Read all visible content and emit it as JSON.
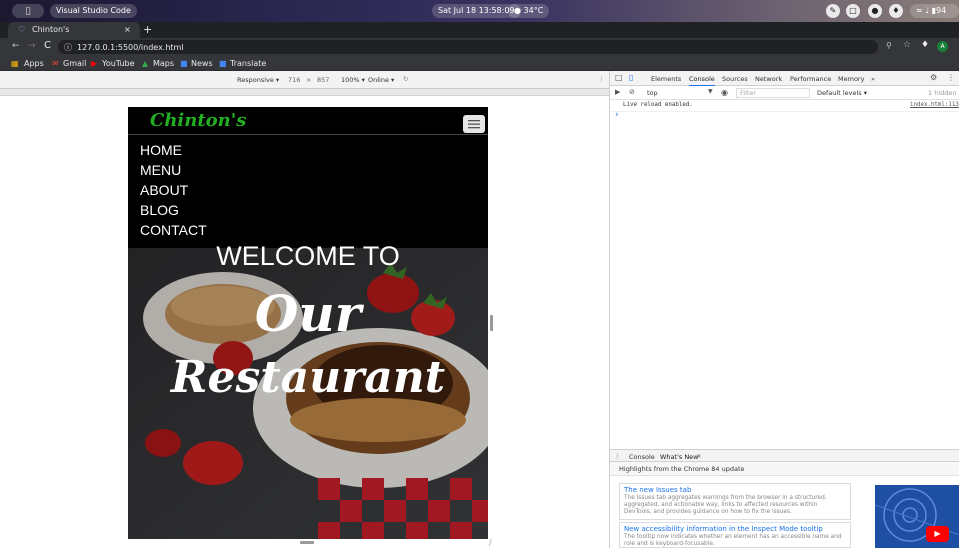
{
  "os_bar": {
    "app_name": "Visual Studio Code",
    "datetime": "Sat Jul 18  13:58:09",
    "weather": "34°C",
    "battery": "94"
  },
  "browser": {
    "tab_title": "Chinton's",
    "url": "127.0.0.1:5500/index.html",
    "bookmarks": [
      "Apps",
      "Gmail",
      "YouTube",
      "Maps",
      "News",
      "Translate"
    ]
  },
  "device_toolbar": {
    "mode": "Responsive ▾",
    "width": "716",
    "times": "×",
    "height": "857",
    "zoom": "100% ▾",
    "network": "Online ▾"
  },
  "site": {
    "logo": "Chinton's",
    "nav": [
      "HOME",
      "MENU",
      "ABOUT",
      "BLOG",
      "CONTACT"
    ],
    "hero_line1": "WELCOME TO",
    "hero_line2": "Our",
    "hero_line3": "Restaurant"
  },
  "devtools": {
    "tabs": [
      "Elements",
      "Console",
      "Sources",
      "Network",
      "Performance",
      "Memory",
      "»"
    ],
    "active_tab": "Console",
    "context": "top",
    "filter_placeholder": "Filter",
    "levels": "Default levels ▾",
    "hidden": "1 hidden",
    "log_message": "Live reload enabled.",
    "log_source": "index.html:113",
    "prompt": "›",
    "drawer_tabs": [
      "Console",
      "What's New"
    ],
    "whats_new_header": "Highlights from the Chrome 84 update",
    "cards": [
      {
        "title": "The new Issues tab",
        "body": "The Issues tab aggregates warnings from the browser in a structured, aggregated, and actionable way, links to affected resources within DevTools, and provides guidance on how to fix the issues."
      },
      {
        "title": "New accessibility information in the Inspect Mode tooltip",
        "body": "The tooltip now indicates whether an element has an accessible name and role and is keyboard-focusable."
      }
    ]
  }
}
